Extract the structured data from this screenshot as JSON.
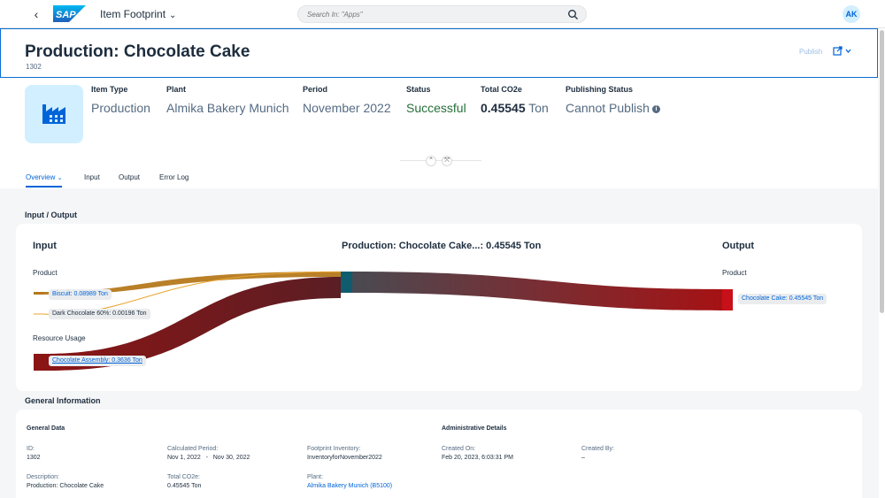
{
  "shell": {
    "app_title": "Item Footprint",
    "search_placeholder": "Search In: \"Apps\"",
    "avatar_initials": "AK",
    "logo_text": "SAP"
  },
  "header": {
    "title": "Production: Chocolate Cake",
    "subtitle": "1302",
    "publish_label": "Publish"
  },
  "attributes": [
    {
      "label": "Item Type",
      "value": "Production"
    },
    {
      "label": "Plant",
      "value": "Almika Bakery Munich"
    },
    {
      "label": "Period",
      "value": "November 2022"
    },
    {
      "label": "Status",
      "value": "Successful"
    },
    {
      "label": "Total CO2e",
      "value_number": "0.45545",
      "value_unit": "Ton"
    },
    {
      "label": "Publishing Status",
      "value": "Cannot Publish"
    }
  ],
  "tabs": [
    {
      "label": "Overview",
      "selected": true
    },
    {
      "label": "Input"
    },
    {
      "label": "Output"
    },
    {
      "label": "Error Log"
    }
  ],
  "io_section": {
    "title": "Input / Output",
    "input_heading": "Input",
    "center_heading": "Production: Chocolate Cake...: 0.45545 Ton",
    "output_heading": "Output",
    "input_product_group": "Product",
    "input_resource_group": "Resource Usage",
    "output_product_group": "Product",
    "inputs": [
      {
        "label": "Biscuit: 0.08989 Ton",
        "value": 0.08989,
        "color": "#b5791c"
      },
      {
        "label": "Dark Chocolate 60%: 0.00196 Ton",
        "value": 0.00196,
        "color": "#e8a530"
      },
      {
        "label": "Chocolate Assembly: 0.3636 Ton",
        "value": 0.3636,
        "color": "#8b1515"
      }
    ],
    "outputs": [
      {
        "label": "Chocolate Cake: 0.45545 Ton",
        "value": 0.45545,
        "color": "#a51214"
      }
    ],
    "center_node_color": "#0f5c6e"
  },
  "general": {
    "title": "General Information",
    "general_data_heading": "General Data",
    "admin_heading": "Administrative Details",
    "fields": {
      "id_label": "ID:",
      "id_value": "1302",
      "calc_label": "Calculated Period:",
      "calc_value": "Nov 1, 2022   -   Nov 30, 2022",
      "inv_label": "Footprint Inventory:",
      "inv_value": "InventoryforNovember2022",
      "created_on_label": "Created On:",
      "created_on_value": "Feb 20, 2023, 6:03:31 PM",
      "created_by_label": "Created By:",
      "created_by_value": "–",
      "desc_label": "Description:",
      "desc_value": "Production: Chocolate Cake",
      "co2_label": "Total CO2e:",
      "co2_value": "0.45545 Ton",
      "plant_label": "Plant:",
      "plant_value": "Almika Bakery Munich (B5100)"
    }
  }
}
